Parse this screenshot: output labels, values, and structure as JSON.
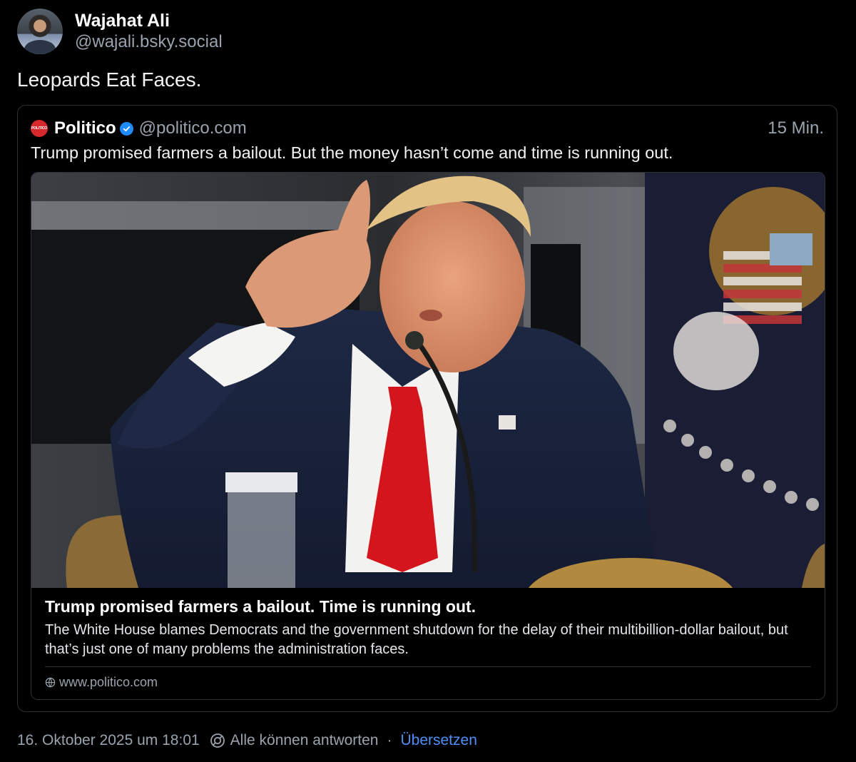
{
  "post": {
    "author_name": "Wajahat Ali",
    "author_handle": "@wajali.bsky.social",
    "text": "Leopards Eat Faces."
  },
  "quote": {
    "logo_text": "POLITICO",
    "author_name": "Politico",
    "author_handle": "@politico.com",
    "time": "15 Min.",
    "text": "Trump promised farmers a bailout. But the money hasn’t come and time is running out."
  },
  "external": {
    "title": "Trump promised farmers a bailout. Time is running out.",
    "description": "The White House blames Democrats and the government shutdown for the delay of their multibillion-dollar bailout, but that’s just one of many problems the administration faces.",
    "domain": "www.politico.com"
  },
  "footer": {
    "date": "16. Oktober 2025 um 18:01",
    "reply_setting": "Alle können antworten",
    "separator": "·",
    "translate": "Übersetzen"
  },
  "colors": {
    "background": "#000000",
    "muted": "#9aa3ad",
    "link": "#4f8ff7",
    "verified": "#208bfe",
    "politico_red": "#d6282d"
  }
}
